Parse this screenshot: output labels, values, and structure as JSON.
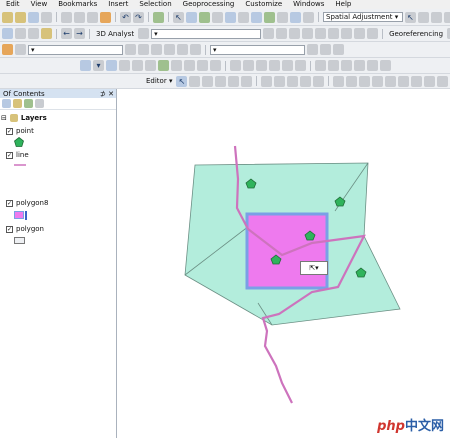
{
  "menu": [
    "Edit",
    "View",
    "Bookmarks",
    "Insert",
    "Selection",
    "Geoprocessing",
    "Customize",
    "Windows",
    "Help"
  ],
  "toolbar": {
    "spatial_adjustment": "Spatial Adjustment",
    "analyst_3d": "3D Analyst",
    "georeferencing": "Georeferencing",
    "editor": "Editor"
  },
  "toc": {
    "title": "Of Contents",
    "pin": "⊅ ✕",
    "root": "Layers",
    "layers": [
      "point",
      "line",
      "polygon8",
      "polygon"
    ]
  },
  "map": {
    "mini_button": "⇱▾",
    "watermark_php": "php",
    "watermark_cn": "中文网",
    "colors": {
      "polygon_fill": "#b3eddc",
      "selection_fill": "#ee7aee",
      "selection_border": "#7aa0e6",
      "line": "#cd73bd",
      "point": "#2fb35c"
    }
  }
}
